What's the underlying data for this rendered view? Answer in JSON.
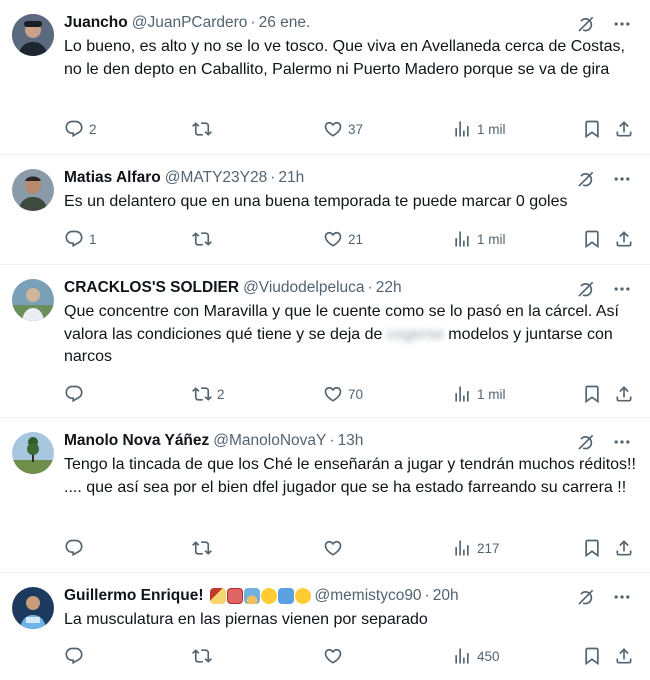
{
  "tweets": [
    {
      "name": "Juancho",
      "handle": "@JuanPCardero",
      "time": "26 ene.",
      "text": "Lo bueno, es alto y no se lo ve tosco. Que viva en Avellaneda cerca de Costas, no le den depto en Caballito, Palermo ni Puerto Madero porque se va de gira",
      "replies": "2",
      "retweets": "",
      "likes": "37",
      "views": "1 mil"
    },
    {
      "name": "Matias Alfaro",
      "handle": "@MATY23Y28",
      "time": "21h",
      "text": "Es un delantero que en una buena temporada te puede marcar 0 goles",
      "replies": "1",
      "retweets": "",
      "likes": "21",
      "views": "1 mil"
    },
    {
      "name": "CRACKLOS'S SOLDIER",
      "handle": "@Viudodelpeluca",
      "time": "22h",
      "text_a": "Que concentre con Maravilla y que le cuente como se lo pasó en la cárcel. Así valora las condiciones qué tiene y se deja de ",
      "text_blur": "cogerse",
      "text_b": " modelos y juntarse con narcos",
      "replies": "",
      "retweets": "2",
      "likes": "70",
      "views": "1 mil"
    },
    {
      "name": "Manolo Nova Yáñez",
      "handle": "@ManoloNovaY",
      "time": "13h",
      "text": "Tengo la tincada de que los Ché le enseñarán a jugar y tendrán muchos réditos!! .... que así sea por el bien dfel jugador que se ha estado farreando su carrera !!",
      "replies": "",
      "retweets": "",
      "likes": "",
      "views": "217"
    },
    {
      "name": "Guillermo Enrique!",
      "handle": "@memistyco90",
      "time": "20h",
      "text": "La musculatura en las piernas vienen por separado",
      "replies": "",
      "retweets": "",
      "likes": "",
      "views": "450"
    }
  ],
  "dot": "·",
  "colors": {
    "text": "#0f1419",
    "muted": "#536471",
    "divider": "#eff3f4"
  }
}
